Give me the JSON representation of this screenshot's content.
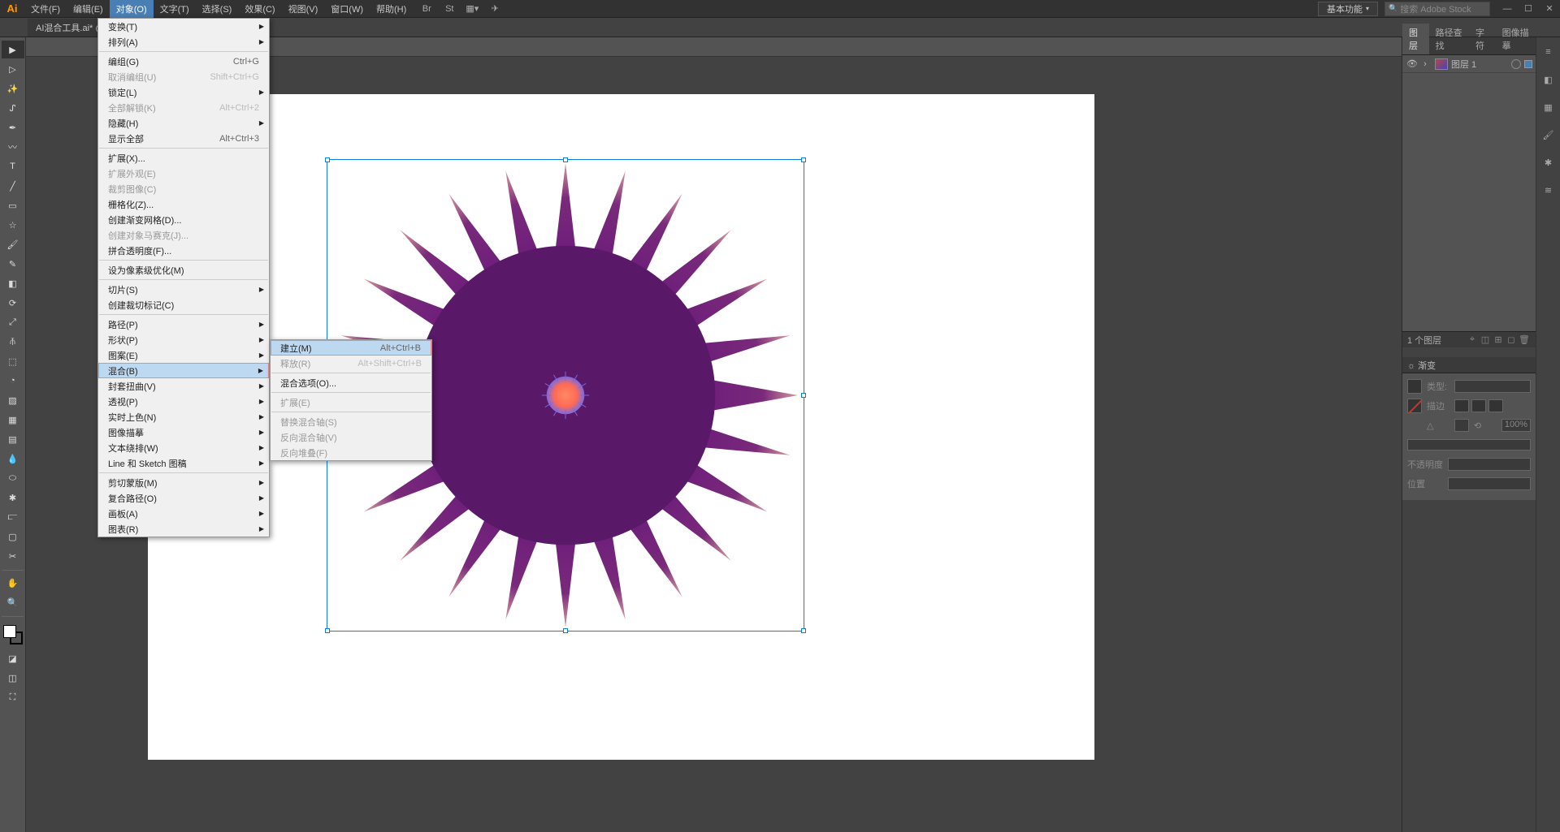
{
  "app_logo": "Ai",
  "menubar": [
    "文件(F)",
    "编辑(E)",
    "对象(O)",
    "文字(T)",
    "选择(S)",
    "效果(C)",
    "视图(V)",
    "窗口(W)",
    "帮助(H)"
  ],
  "menubar_active_index": 2,
  "workspace": "基本功能",
  "search_placeholder": "搜索 Adobe Stock",
  "doc_tab": "AI混合工具.ai* @",
  "object_menu": [
    {
      "label": "变换(T)",
      "arrow": true
    },
    {
      "label": "排列(A)",
      "arrow": true
    },
    {
      "sep": true
    },
    {
      "label": "编组(G)",
      "shortcut": "Ctrl+G"
    },
    {
      "label": "取消编组(U)",
      "shortcut": "Shift+Ctrl+G",
      "disabled": true
    },
    {
      "label": "锁定(L)",
      "arrow": true
    },
    {
      "label": "全部解锁(K)",
      "shortcut": "Alt+Ctrl+2",
      "disabled": true
    },
    {
      "label": "隐藏(H)",
      "arrow": true
    },
    {
      "label": "显示全部",
      "shortcut": "Alt+Ctrl+3"
    },
    {
      "sep": true
    },
    {
      "label": "扩展(X)..."
    },
    {
      "label": "扩展外观(E)",
      "disabled": true
    },
    {
      "label": "裁剪图像(C)",
      "disabled": true
    },
    {
      "label": "栅格化(Z)..."
    },
    {
      "label": "创建渐变网格(D)..."
    },
    {
      "label": "创建对象马赛克(J)...",
      "disabled": true
    },
    {
      "label": "拼合透明度(F)..."
    },
    {
      "sep": true
    },
    {
      "label": "设为像素级优化(M)"
    },
    {
      "sep": true
    },
    {
      "label": "切片(S)",
      "arrow": true
    },
    {
      "label": "创建裁切标记(C)"
    },
    {
      "sep": true
    },
    {
      "label": "路径(P)",
      "arrow": true
    },
    {
      "label": "形状(P)",
      "arrow": true
    },
    {
      "label": "图案(E)",
      "arrow": true
    },
    {
      "label": "混合(B)",
      "arrow": true,
      "highlight": true
    },
    {
      "label": "封套扭曲(V)",
      "arrow": true
    },
    {
      "label": "透视(P)",
      "arrow": true
    },
    {
      "label": "实时上色(N)",
      "arrow": true
    },
    {
      "label": "图像描摹",
      "arrow": true
    },
    {
      "label": "文本绕排(W)",
      "arrow": true
    },
    {
      "label": "Line 和 Sketch 图稿",
      "arrow": true
    },
    {
      "sep": true
    },
    {
      "label": "剪切蒙版(M)",
      "arrow": true
    },
    {
      "label": "复合路径(O)",
      "arrow": true
    },
    {
      "label": "画板(A)",
      "arrow": true
    },
    {
      "label": "图表(R)",
      "arrow": true
    }
  ],
  "blend_submenu": [
    {
      "label": "建立(M)",
      "shortcut": "Alt+Ctrl+B",
      "highlight": true
    },
    {
      "label": "释放(R)",
      "shortcut": "Alt+Shift+Ctrl+B",
      "disabled": true
    },
    {
      "sep": true
    },
    {
      "label": "混合选项(O)..."
    },
    {
      "sep": true
    },
    {
      "label": "扩展(E)",
      "disabled": true
    },
    {
      "sep": true
    },
    {
      "label": "替换混合轴(S)",
      "disabled": true
    },
    {
      "label": "反向混合轴(V)",
      "disabled": true
    },
    {
      "label": "反向堆叠(F)",
      "disabled": true
    }
  ],
  "right_panel": {
    "tabs": [
      "图层",
      "路径查找",
      "字符",
      "图像描摹"
    ],
    "active_tab": 0,
    "layer_name": "图层 1",
    "footer_text": "1 个图层"
  },
  "gradient_panel": {
    "title": "☼ 渐变",
    "type_label": "类型:",
    "stroke_label": "描边",
    "angle_icon": "△",
    "ratio_icon": "⟲",
    "ratio_value": "100%",
    "opacity_label": "不透明度",
    "position_label": "位置"
  }
}
